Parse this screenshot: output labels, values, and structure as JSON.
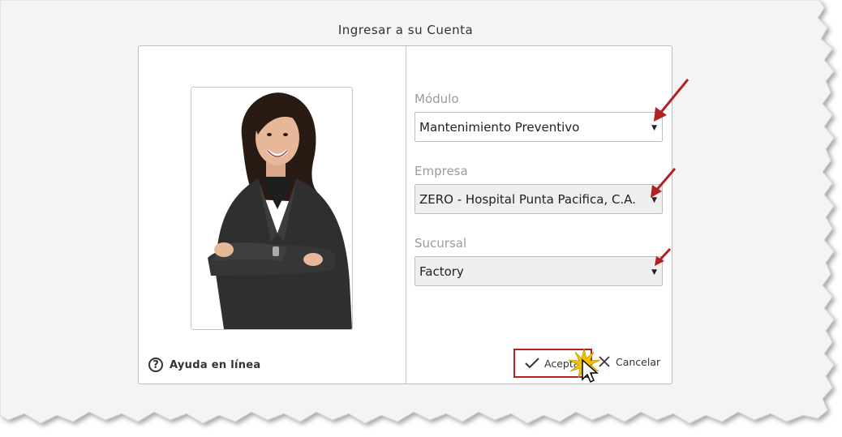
{
  "dialog": {
    "title": "Ingresar a su Cuenta"
  },
  "help": {
    "icon": "question-circle-icon",
    "label": "Ayuda en línea"
  },
  "form": {
    "modulo": {
      "label": "Módulo",
      "value": "Mantenimiento Preventivo"
    },
    "empresa": {
      "label": "Empresa",
      "value": "ZERO - Hospital Punta Pacifica, C.A."
    },
    "sucursal": {
      "label": "Sucursal",
      "value": "Factory"
    }
  },
  "actions": {
    "accept_label": "Aceptar",
    "cancel_label": "Cancelar"
  },
  "colors": {
    "annotation_arrow": "#b22222",
    "accept_highlight": "#b22222",
    "label_gray": "#9a9a9a"
  }
}
